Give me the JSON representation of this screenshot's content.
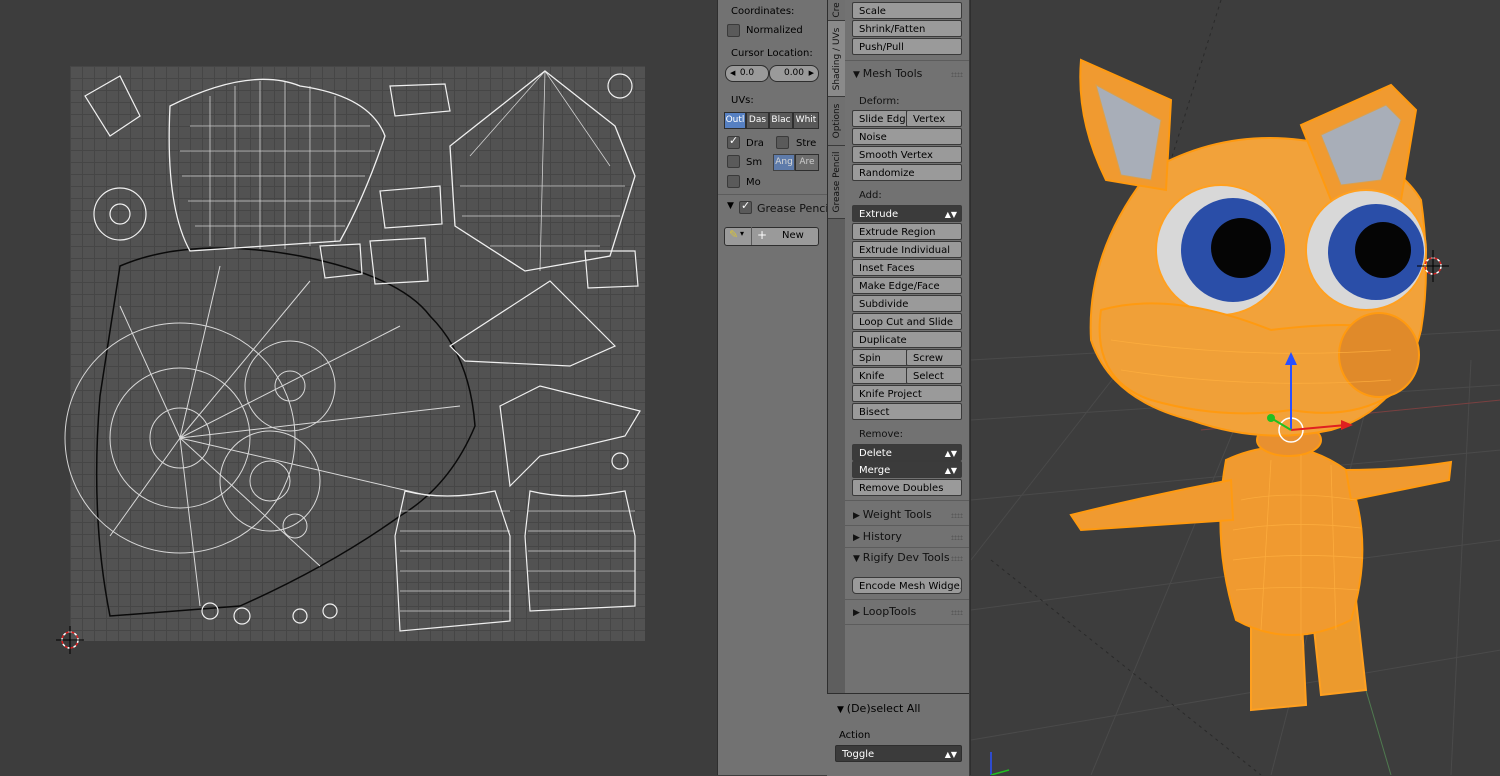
{
  "uv_toolshelf": {
    "coordinates_label": "Coordinates:",
    "normalized_label": "Normalized",
    "cursor_location_label": "Cursor Location:",
    "cursor_x": "0.0",
    "cursor_y": "0.00",
    "uvs_label": "UVs:",
    "uv_modes": [
      "Outl",
      "Das",
      "Blac",
      "Whit"
    ],
    "draw_faces_label": "Dra",
    "stretch_label": "Stre",
    "smooth_label": "Sm",
    "angle_label": "Ang",
    "area_label": "Are",
    "modified_label": "Mo",
    "grease_pencil_label": "Grease Pencil",
    "new_label": "New"
  },
  "tab_strip": {
    "tabs": [
      "Cre",
      "Shading / UVs",
      "Options",
      "Grease Pencil"
    ]
  },
  "mesh_panel": {
    "transform_buttons": [
      "Scale",
      "Shrink/Fatten",
      "Push/Pull"
    ],
    "mesh_tools_title": "Mesh Tools",
    "deform_label": "Deform:",
    "slide_edge": "Slide Edg",
    "vertex": "Vertex",
    "noise": "Noise",
    "smooth_vertex": "Smooth Vertex",
    "randomize": "Randomize",
    "add_label": "Add:",
    "extrude": "Extrude",
    "extrude_region": "Extrude Region",
    "extrude_individual": "Extrude Individual",
    "inset_faces": "Inset Faces",
    "make_edge_face": "Make Edge/Face",
    "subdivide": "Subdivide",
    "loop_cut": "Loop Cut and Slide",
    "duplicate": "Duplicate",
    "spin": "Spin",
    "screw": "Screw",
    "knife": "Knife",
    "select": "Select",
    "knife_project": "Knife Project",
    "bisect": "Bisect",
    "remove_label": "Remove:",
    "delete": "Delete",
    "merge": "Merge",
    "remove_doubles": "Remove Doubles",
    "weight_tools": "Weight Tools",
    "history": "History",
    "rigify_dev_tools": "Rigify Dev Tools",
    "encode_mesh": "Encode Mesh Widge...",
    "loop_tools": "LoopTools"
  },
  "redo_panel": {
    "title": "(De)select All",
    "action_label": "Action",
    "action_value": "Toggle"
  },
  "colors": {
    "selection": "#ff8c00",
    "uv_active": "#5680c2",
    "panel": "#727272"
  }
}
